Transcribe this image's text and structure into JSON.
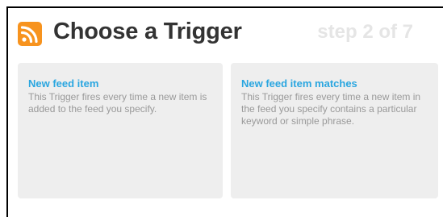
{
  "header": {
    "title": "Choose a Trigger",
    "step": "step 2 of 7",
    "icon": "rss-icon",
    "icon_color": "#f7931e"
  },
  "triggers": [
    {
      "title": "New feed item",
      "description": "This Trigger fires every time a new item is added to the feed you specify."
    },
    {
      "title": "New feed item matches",
      "description": "This Trigger fires every time a new item in the feed you specify contains a particular keyword or simple phrase."
    }
  ],
  "colors": {
    "accent": "#2aa6e0",
    "card_background": "#eeeeee",
    "title_text": "#333333",
    "step_text": "#e5e5e5",
    "description_text": "#999999"
  }
}
